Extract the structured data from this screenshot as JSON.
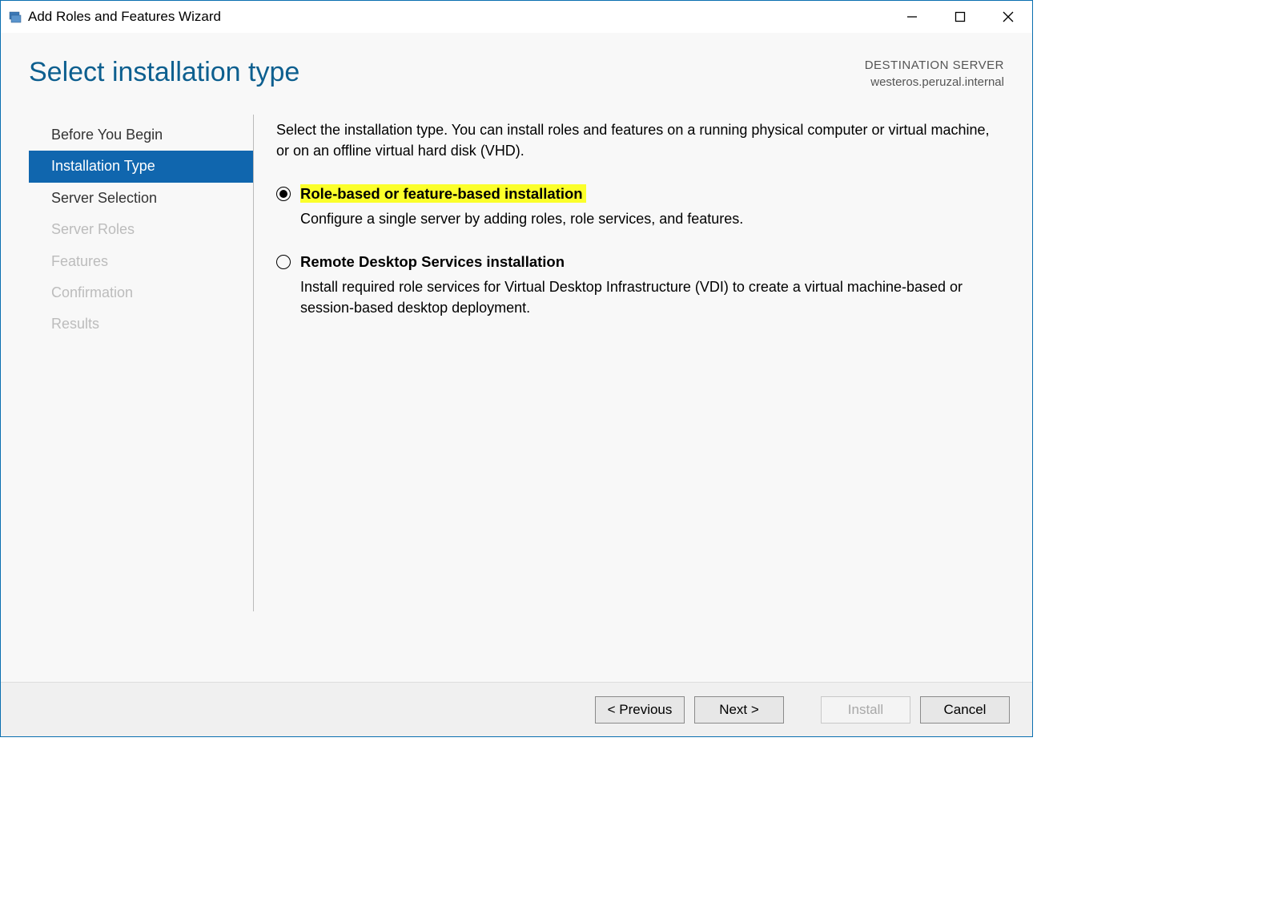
{
  "window": {
    "title": "Add Roles and Features Wizard"
  },
  "header": {
    "page_title": "Select installation type",
    "destination_label": "DESTINATION SERVER",
    "destination_value": "westeros.peruzal.internal"
  },
  "sidebar": {
    "items": [
      {
        "label": "Before You Begin",
        "state": "normal"
      },
      {
        "label": "Installation Type",
        "state": "active"
      },
      {
        "label": "Server Selection",
        "state": "normal"
      },
      {
        "label": "Server Roles",
        "state": "disabled"
      },
      {
        "label": "Features",
        "state": "disabled"
      },
      {
        "label": "Confirmation",
        "state": "disabled"
      },
      {
        "label": "Results",
        "state": "disabled"
      }
    ]
  },
  "content": {
    "intro": "Select the installation type. You can install roles and features on a running physical computer or virtual machine, or on an offline virtual hard disk (VHD).",
    "options": [
      {
        "title": "Role-based or feature-based installation",
        "desc": "Configure a single server by adding roles, role services, and features.",
        "selected": true,
        "highlighted": true
      },
      {
        "title": "Remote Desktop Services installation",
        "desc": "Install required role services for Virtual Desktop Infrastructure (VDI) to create a virtual machine-based or session-based desktop deployment.",
        "selected": false,
        "highlighted": false
      }
    ]
  },
  "footer": {
    "previous": "< Previous",
    "next": "Next >",
    "install": "Install",
    "cancel": "Cancel"
  }
}
